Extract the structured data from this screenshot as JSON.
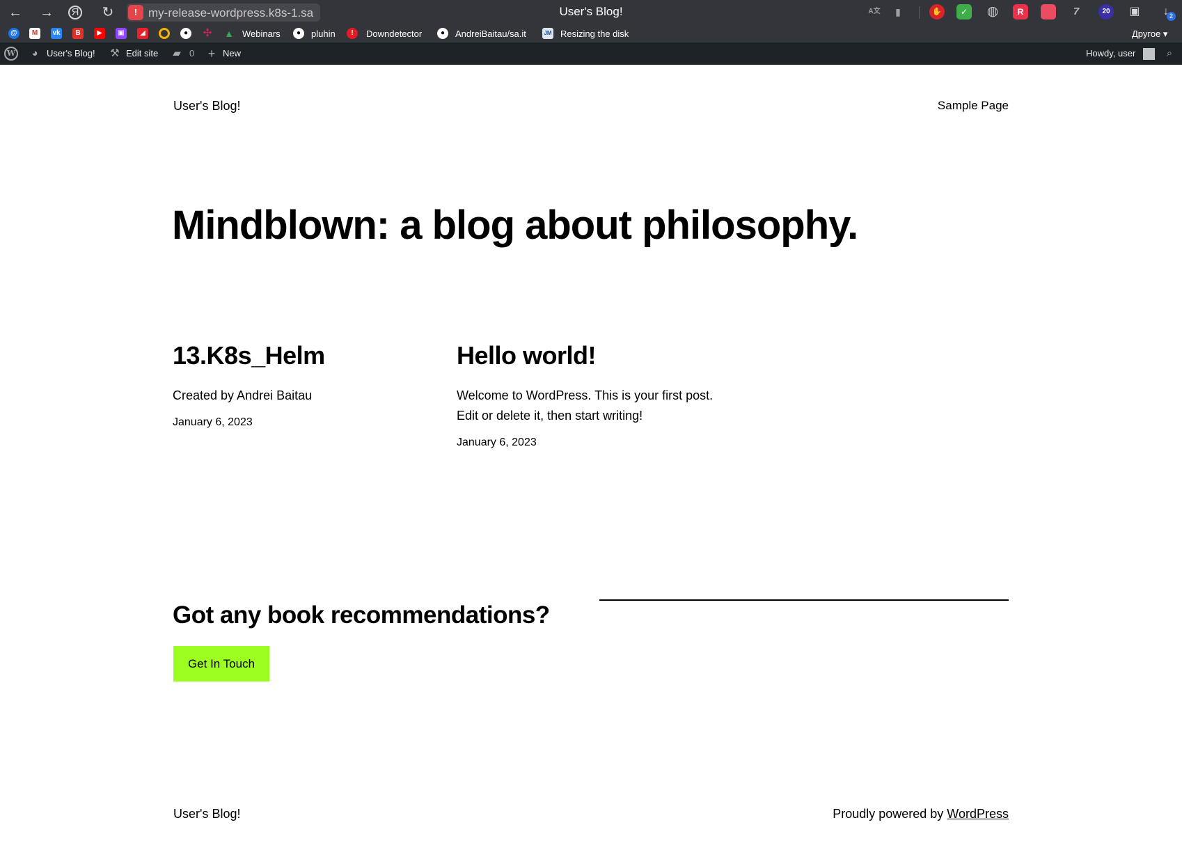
{
  "browser": {
    "address_text": "my-release-wordpress.k8s-1.sa",
    "window_title": "User's Blog!",
    "nav": {
      "back": "←",
      "forward": "→",
      "yandex": "Я",
      "reload": "↻"
    },
    "extensions": {
      "translate": "A文",
      "bookmark": "▮",
      "adblock": "✋",
      "shield": "✓",
      "globe": "◍",
      "ext_r": "R",
      "ext_cal": " ",
      "ext_seven": "7",
      "ext_badge": "20",
      "collections": "▣",
      "downloads": "↓",
      "downloads_count": "2"
    },
    "bookmarks": {
      "items": [
        {
          "label": "Webinars"
        },
        {
          "label": "pluhin"
        },
        {
          "label": "Downdetector"
        },
        {
          "label": "AndreiBaitau/sa.it"
        },
        {
          "label": "Resizing the disk"
        }
      ],
      "other": "Другое ▾"
    }
  },
  "adminbar": {
    "site_name": "User's Blog!",
    "edit_site": "Edit site",
    "comments_count": "0",
    "new_label": "New",
    "howdy": "Howdy, user"
  },
  "site": {
    "title": "User's Blog!",
    "nav": [
      "Sample Page"
    ]
  },
  "hero": {
    "heading": "Mindblown: a blog about philosophy."
  },
  "posts": [
    {
      "title": "13.K8s_Helm",
      "excerpt": "Created by Andrei Baitau",
      "date": "January 6, 2023"
    },
    {
      "title": "Hello world!",
      "excerpt": "Welcome to WordPress. This is your first post. Edit or delete it, then start writing!",
      "date": "January 6, 2023"
    }
  ],
  "cta": {
    "heading": "Got any book recommendations?",
    "button": "Get In Touch"
  },
  "footer": {
    "title": "User's Blog!",
    "credit_prefix": "Proudly powered by ",
    "credit_link": "WordPress"
  },
  "colors": {
    "accent": "#9dff20",
    "adminbar": "#1d2327",
    "chrome": "#34353a"
  }
}
